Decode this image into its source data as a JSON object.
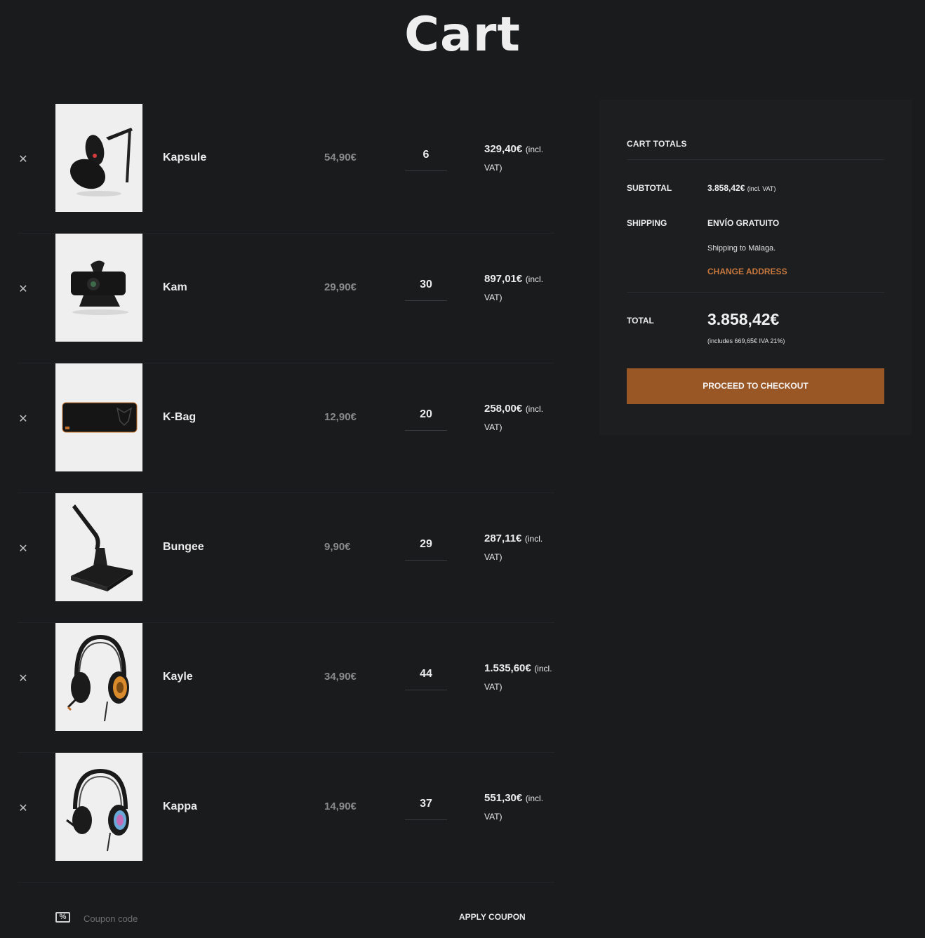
{
  "page": {
    "title": "Cart"
  },
  "cart": {
    "remove_symbol": "✕",
    "items": [
      {
        "name": "Kapsule",
        "price": "54,90€",
        "quantity": "6",
        "subtotal": "329,40€",
        "vat_note": "(incl. VAT)",
        "image_icon": "microphone-icon"
      },
      {
        "name": "Kam",
        "price": "29,90€",
        "quantity": "30",
        "subtotal": "897,01€",
        "vat_note": "(incl. VAT)",
        "image_icon": "webcam-icon"
      },
      {
        "name": "K-Bag",
        "price": "12,90€",
        "quantity": "20",
        "subtotal": "258,00€",
        "vat_note": "(incl. VAT)",
        "image_icon": "mousepad-icon"
      },
      {
        "name": "Bungee",
        "price": "9,90€",
        "quantity": "29",
        "subtotal": "287,11€",
        "vat_note": "(incl. VAT)",
        "image_icon": "mouse-bungee-icon"
      },
      {
        "name": "Kayle",
        "price": "34,90€",
        "quantity": "44",
        "subtotal": "1.535,60€",
        "vat_note": "(incl. VAT)",
        "image_icon": "headset-icon"
      },
      {
        "name": "Kappa",
        "price": "14,90€",
        "quantity": "37",
        "subtotal": "551,30€",
        "vat_note": "(incl. VAT)",
        "image_icon": "headset-icon"
      }
    ]
  },
  "coupon": {
    "placeholder": "Coupon code",
    "apply_label": "APPLY COUPON",
    "icon_glyph": "%"
  },
  "totals": {
    "title": "CART TOTALS",
    "subtotal_label": "SUBTOTAL",
    "subtotal_value": "3.858,42€",
    "subtotal_vat": "(incl. VAT)",
    "shipping_label": "SHIPPING",
    "shipping_method": "ENVÍO GRATUITO",
    "shipping_note": "Shipping to Málaga.",
    "change_address": "CHANGE ADDRESS",
    "total_label": "TOTAL",
    "total_value": "3.858,42€",
    "tax_note": "(includes 669,65€ IVA 21%)",
    "checkout_label": "PROCEED TO CHECKOUT"
  },
  "colors": {
    "background": "#1a1b1d",
    "panel": "#1c1e20",
    "accent": "#9a5726",
    "link": "#c8773d",
    "muted_price": "#8a8a8a"
  }
}
